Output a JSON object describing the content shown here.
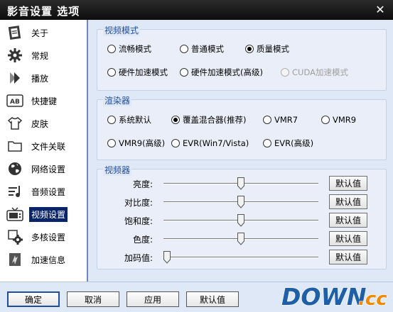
{
  "window": {
    "title": "影音设置 选项",
    "close_glyph": "✕"
  },
  "sidebar": {
    "items": [
      {
        "label": "关于",
        "icon": "info-icon"
      },
      {
        "label": "常规",
        "icon": "gear-icon"
      },
      {
        "label": "播放",
        "icon": "play-icon"
      },
      {
        "label": "快捷键",
        "icon": "keyboard-icon"
      },
      {
        "label": "皮肤",
        "icon": "shirt-icon"
      },
      {
        "label": "文件关联",
        "icon": "folder-icon"
      },
      {
        "label": "网络设置",
        "icon": "globe-icon"
      },
      {
        "label": "音频设置",
        "icon": "audio-icon"
      },
      {
        "label": "视频设置",
        "icon": "tv-icon",
        "selected": true
      },
      {
        "label": "多核设置",
        "icon": "multicore-icon"
      },
      {
        "label": "加速信息",
        "icon": "accel-icon"
      }
    ]
  },
  "video_mode": {
    "title": "视频模式",
    "options": [
      {
        "label": "流畅模式",
        "checked": false,
        "disabled": false
      },
      {
        "label": "普通模式",
        "checked": false,
        "disabled": false
      },
      {
        "label": "质量模式",
        "checked": true,
        "disabled": false
      },
      {
        "label": "硬件加速模式",
        "checked": false,
        "disabled": false
      },
      {
        "label": "硬件加速模式(高级)",
        "checked": false,
        "disabled": false
      },
      {
        "label": "CUDA加速模式",
        "checked": false,
        "disabled": true
      }
    ]
  },
  "renderer": {
    "title": "渲染器",
    "options": [
      {
        "label": "系统默认",
        "checked": false
      },
      {
        "label": "覆盖混合器(推荐)",
        "checked": true
      },
      {
        "label": "VMR7",
        "checked": false
      },
      {
        "label": "VMR9",
        "checked": false
      },
      {
        "label": "VMR9(高级)",
        "checked": false
      },
      {
        "label": "EVR(Win7/Vista)",
        "checked": false
      },
      {
        "label": "EVR(高级)",
        "checked": false
      }
    ]
  },
  "video": {
    "title": "视频器",
    "sliders": [
      {
        "label": "亮度:",
        "value": 0.5,
        "button": "默认值"
      },
      {
        "label": "对比度:",
        "value": 0.5,
        "button": "默认值"
      },
      {
        "label": "饱和度:",
        "value": 0.5,
        "button": "默认值"
      },
      {
        "label": "色度:",
        "value": 0.5,
        "button": "默认值"
      },
      {
        "label": "加码值:",
        "value": 0.0,
        "button": "默认值"
      }
    ]
  },
  "footer": {
    "ok": "确定",
    "cancel": "取消",
    "apply": "应用",
    "default": "默认值"
  },
  "watermark": {
    "text": "DOWN",
    "suffix": ".cc"
  },
  "colors": {
    "accent": "#1f4ea0",
    "selection": "#0a246a",
    "watermark_blue": "#1f5fa8",
    "watermark_orange": "#f08a00"
  }
}
